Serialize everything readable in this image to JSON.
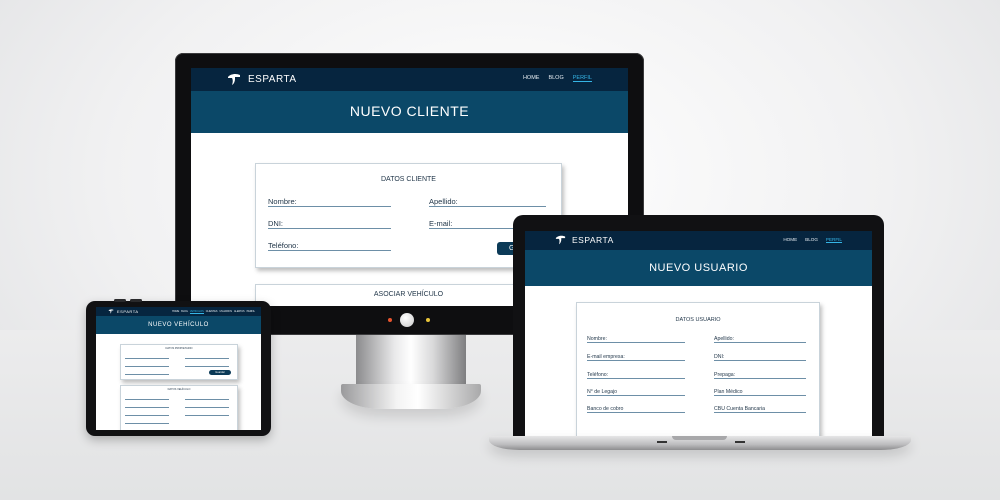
{
  "brand": {
    "name": "ESPARTA"
  },
  "colors": {
    "nav": "#06253f",
    "banner": "#0b4868",
    "accent": "#35b5e6",
    "button": "#0b3a57"
  },
  "desktop": {
    "nav": [
      "HOME",
      "BLOG",
      "PERFIL"
    ],
    "banner_title": "NUEVO CLIENTE",
    "card1": {
      "title": "DATOS CLIENTE",
      "fields": [
        "Nombre:",
        "Apellido:",
        "DNI:",
        "E-mail:",
        "Teléfono:"
      ],
      "button": "Gu"
    },
    "card2": {
      "title": "ASOCIAR VEHÍCULO"
    }
  },
  "laptop": {
    "nav": [
      "HOME",
      "BLOG",
      "PERFIL"
    ],
    "banner_title": "NUEVO USUARIO",
    "card": {
      "title": "DATOS USUARIO",
      "fields": [
        "Nombre:",
        "Apellido:",
        "E-mail empresa:",
        "DNI:",
        "Teléfono:",
        "Prepaga:",
        "N° de Legajo",
        "Plan Médico",
        "Banco de cobro",
        "CBU Cuenta Bancaria"
      ]
    }
  },
  "tablet": {
    "banner_title": "NUEVO VEHÍCULO",
    "nav": [
      "HOME",
      "BLOG",
      "VEHICULOS",
      "CLIENTES",
      "USUARIOS",
      "ALERTAS",
      "PERFIL"
    ],
    "card1": {
      "title": "DATOS PROPIETARIO",
      "button": "Guardar"
    },
    "card2": {
      "title": "DATOS VEHÍCULO"
    }
  }
}
